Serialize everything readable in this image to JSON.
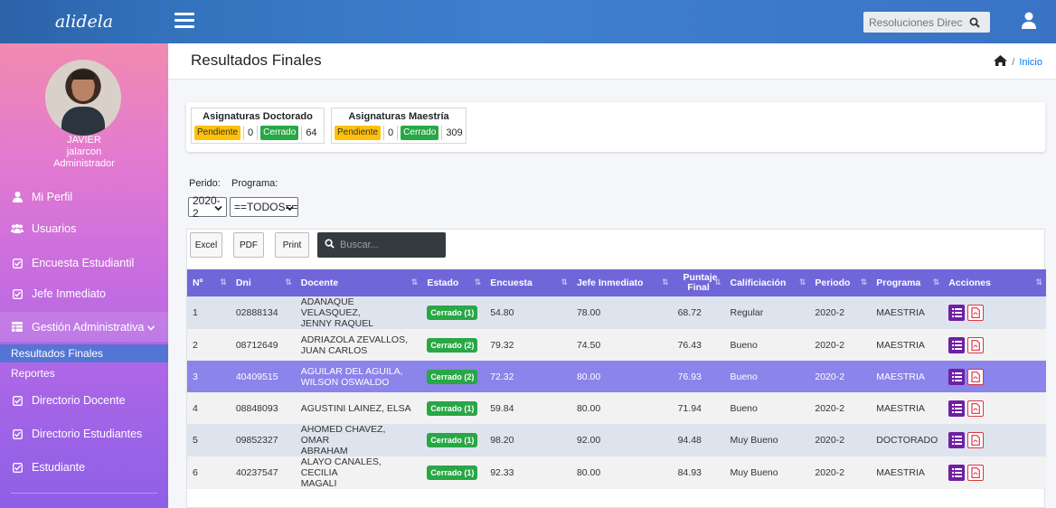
{
  "brand": "alidela",
  "search": {
    "placeholder": "Resoluciones Directo"
  },
  "user": {
    "name": "JAVIER",
    "username": "jalarcon",
    "role": "Administrador"
  },
  "sidebar": {
    "items": [
      {
        "label": "Mi Perfil"
      },
      {
        "label": "Usuarios"
      },
      {
        "label": "Encuesta Estudiantil"
      },
      {
        "label": "Jefe Inmediato"
      },
      {
        "label": "Gestión Administrativa"
      },
      {
        "label": "Resultados Finales"
      },
      {
        "label": "Reportes"
      },
      {
        "label": "Directorio Docente"
      },
      {
        "label": "Directorio Estudiantes"
      },
      {
        "label": "Estudiante"
      }
    ]
  },
  "header": {
    "title": "Resultados Finales",
    "breadcrumb": "Inicio"
  },
  "summary": {
    "doctorado": {
      "title": "Asignaturas Doctorado",
      "pendiente_label": "Pendiente",
      "pendiente": "0",
      "cerrado_label": "Cerrado",
      "cerrado": "64"
    },
    "maestria": {
      "title": "Asignaturas Maestría",
      "pendiente_label": "Pendiente",
      "pendiente": "0",
      "cerrado_label": "Cerrado",
      "cerrado": "309"
    }
  },
  "filters": {
    "periodo_label": "Perido:",
    "programa_label": "Programa:",
    "periodo_value": "2020-2",
    "programa_value": "==TODOS=="
  },
  "toolbar": {
    "excel": "Excel",
    "pdf": "PDF",
    "print": "Print",
    "search_placeholder": "Buscar..."
  },
  "table": {
    "headers": [
      "Nº",
      "Dni",
      "Docente",
      "Estado",
      "Encuesta",
      "Jefe Inmediato",
      "Puntaje Final",
      "Calificiación",
      "Periodo",
      "Programa",
      "Acciones"
    ],
    "rows": [
      {
        "n": "1",
        "dni": "02888134",
        "docente_1": "ADANAQUE VELASQUEZ,",
        "docente_2": "JENNY RAQUEL",
        "estado": "Cerrado (1)",
        "encuesta": "54.80",
        "jefe": "78.00",
        "puntaje": "68.72",
        "calif": "Regular",
        "periodo": "2020-2",
        "programa": "MAESTRIA"
      },
      {
        "n": "2",
        "dni": "08712649",
        "docente_1": "ADRIAZOLA ZEVALLOS,",
        "docente_2": "JUAN CARLOS",
        "estado": "Cerrado (2)",
        "encuesta": "79.32",
        "jefe": "74.50",
        "puntaje": "76.43",
        "calif": "Bueno",
        "periodo": "2020-2",
        "programa": "MAESTRIA"
      },
      {
        "n": "3",
        "dni": "40409515",
        "docente_1": "AGUILAR DEL AGUILA,",
        "docente_2": "WILSON OSWALDO",
        "estado": "Cerrado (2)",
        "encuesta": "72.32",
        "jefe": "80.00",
        "puntaje": "76.93",
        "calif": "Bueno",
        "periodo": "2020-2",
        "programa": "MAESTRIA"
      },
      {
        "n": "4",
        "dni": "08848093",
        "docente_1": "AGUSTINI LAINEZ, ELSA",
        "docente_2": "",
        "estado": "Cerrado (1)",
        "encuesta": "59.84",
        "jefe": "80.00",
        "puntaje": "71.94",
        "calif": "Bueno",
        "periodo": "2020-2",
        "programa": "MAESTRIA"
      },
      {
        "n": "5",
        "dni": "09852327",
        "docente_1": "AHOMED CHAVEZ, OMAR",
        "docente_2": "ABRAHAM",
        "estado": "Cerrado (1)",
        "encuesta": "98.20",
        "jefe": "92.00",
        "puntaje": "94.48",
        "calif": "Muy Bueno",
        "periodo": "2020-2",
        "programa": "DOCTORADO"
      },
      {
        "n": "6",
        "dni": "40237547",
        "docente_1": "ALAYO CANALES, CECILIA",
        "docente_2": "MAGALI",
        "estado": "Cerrado (1)",
        "encuesta": "92.33",
        "jefe": "80.00",
        "puntaje": "84.93",
        "calif": "Muy Bueno",
        "periodo": "2020-2",
        "programa": "MAESTRIA"
      }
    ]
  }
}
